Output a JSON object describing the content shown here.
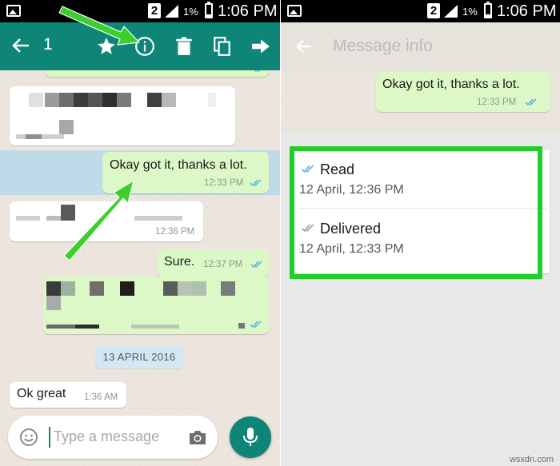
{
  "status_bar": {
    "sim_badge": "2",
    "battery_pct": "1%",
    "time": "1:06 PM"
  },
  "chat_screen": {
    "selected_count": "1",
    "messages": [
      {
        "text": "Okay got it, thanks a lot.",
        "time": "12:33 PM"
      },
      {
        "time": "12:36 PM"
      },
      {
        "text": "Sure.",
        "time": "12:37 PM"
      },
      {
        "text": "Ok great",
        "time": "1:36 AM"
      }
    ],
    "date_chip": "13 APRIL 2016",
    "input_placeholder": "Type a message"
  },
  "info_screen": {
    "title": "Message info",
    "message": {
      "text": "Okay got it, thanks a lot.",
      "time": "12:33 PM"
    },
    "read": {
      "label": "Read",
      "time": "12 April, 12:36 PM"
    },
    "delivered": {
      "label": "Delivered",
      "time": "12 April, 12:33 PM"
    }
  },
  "colors": {
    "action_bar": "#0e8576",
    "outgoing_bubble": "#dcf8c6",
    "read_tick": "#4fb2e6",
    "highlight": "#1fcf27",
    "arrow": "#3ccf2c"
  },
  "icons": {
    "back": "arrow-left-icon",
    "star": "star-icon",
    "info": "info-icon",
    "delete": "trash-icon",
    "copy": "copy-icon",
    "forward": "forward-icon",
    "emoji": "emoji-icon",
    "camera": "camera-icon",
    "mic": "mic-icon"
  },
  "watermark": "wsxdn.com"
}
